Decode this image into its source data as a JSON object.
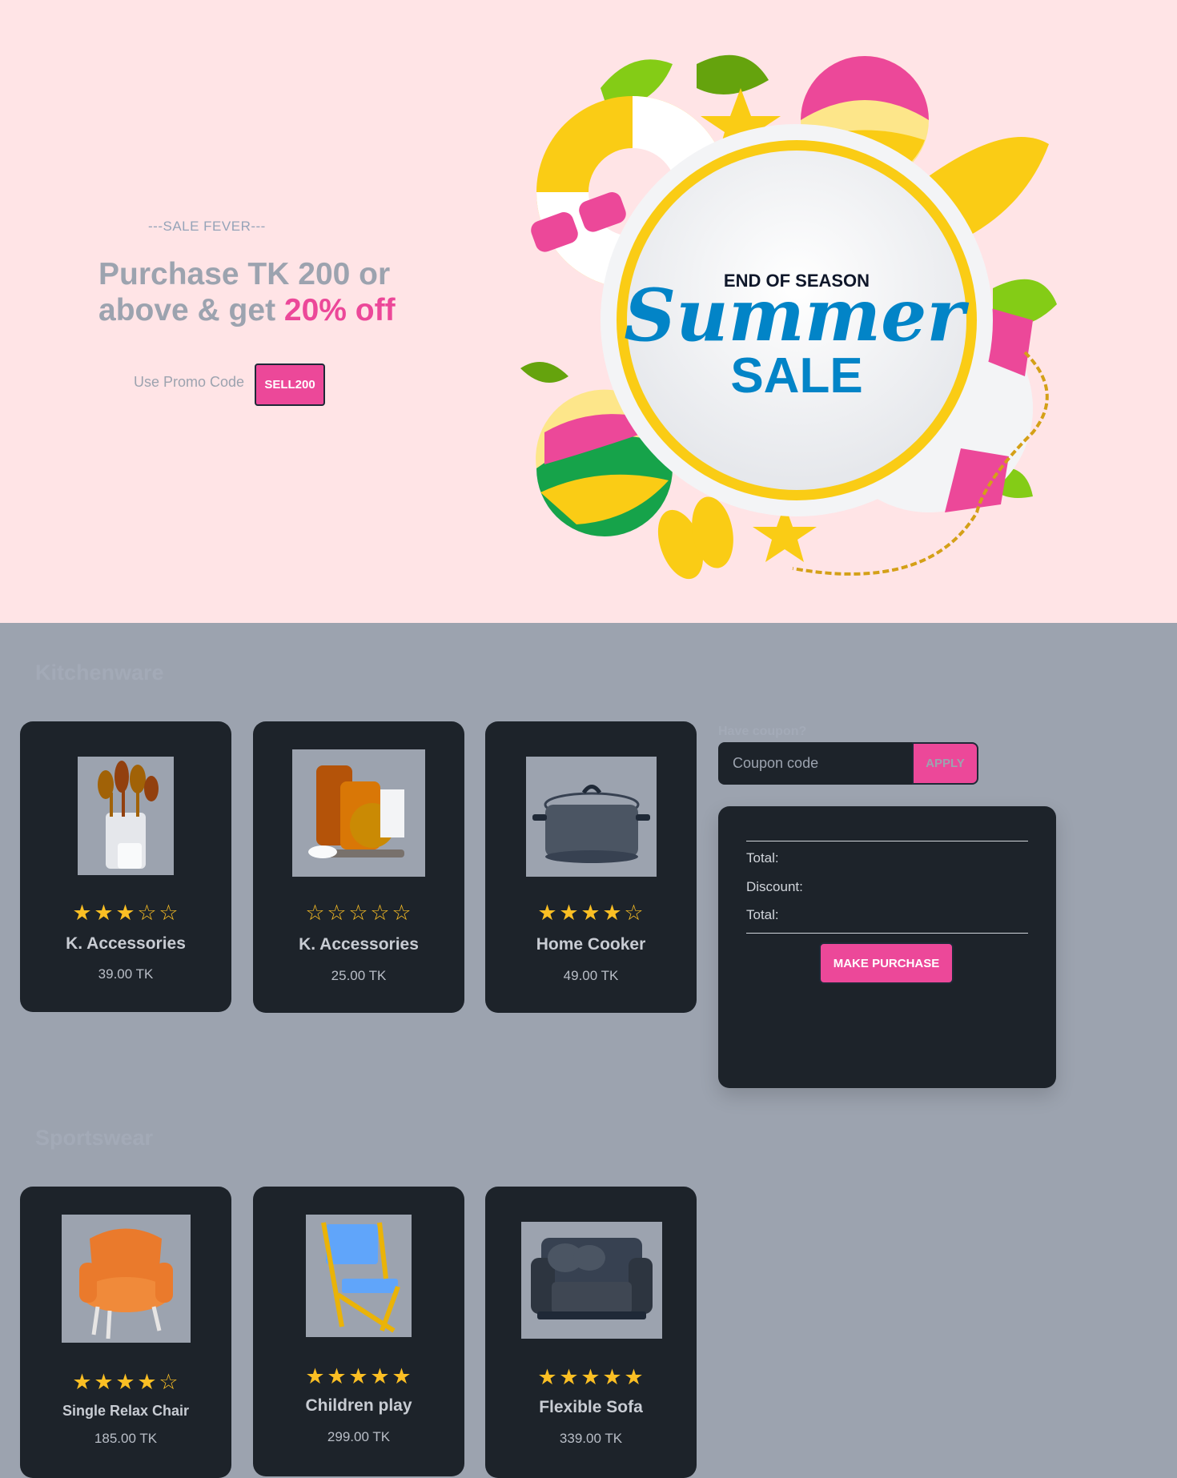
{
  "hero": {
    "eyebrow": "---SALE FEVER---",
    "headline_part1": "Purchase TK 200 or above & get ",
    "headline_highlight": "20% off",
    "promo_label": "Use Promo Code",
    "promo_code": "SELL200",
    "banner": {
      "top": "END OF SEASON",
      "script": "Summer",
      "bottom": "SALE"
    }
  },
  "sections": {
    "kitchenware": {
      "title": "Kitchenware",
      "products": [
        {
          "name": "K. Accessories",
          "price": "39.00 TK",
          "rating": 3,
          "image_icon": "utensil-holder"
        },
        {
          "name": "K. Accessories",
          "price": "25.00 TK",
          "rating": 0,
          "image_icon": "cutting-boards"
        },
        {
          "name": "Home Cooker",
          "price": "49.00 TK",
          "rating": 4,
          "image_icon": "cooking-pot"
        }
      ]
    },
    "sportswear": {
      "title": "Sportswear",
      "products": [
        {
          "name": "Single Relax Chair",
          "price": "185.00 TK",
          "rating": 4,
          "image_icon": "armchair"
        },
        {
          "name": "Children play",
          "price": "299.00 TK",
          "rating": 5,
          "image_icon": "folding-chair"
        },
        {
          "name": "Flexible Sofa",
          "price": "339.00 TK",
          "rating": 5,
          "image_icon": "sofa"
        }
      ]
    }
  },
  "coupon": {
    "label": "Have coupon?",
    "placeholder": "Coupon code",
    "apply_label": "APPLY"
  },
  "summary": {
    "total_label": "Total:",
    "discount_label": "Discount:",
    "grand_total_label": "Total:",
    "purchase_label": "MAKE PURCHASE"
  },
  "colors": {
    "hero_bg": "#ffe4e6",
    "page_bg": "#9ca3af",
    "card_bg": "#1d232a",
    "accent": "#ec4899",
    "star": "#fbbf24"
  }
}
